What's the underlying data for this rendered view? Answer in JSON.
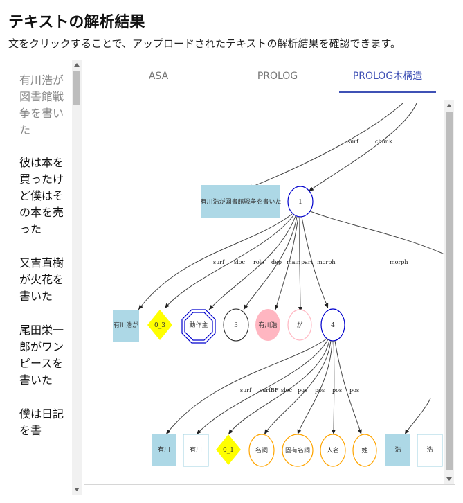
{
  "header": {
    "title": "テキストの解析結果",
    "subtitle": "文をクリックすることで、アップロードされたテキストの解析結果を確認できます。"
  },
  "sentences": [
    "有川浩が図書館戦争を書いた",
    "彼は本を買ったけど僕はその本を売った",
    "又吉直樹が火花を書いた",
    "尾田栄一郎がワンピースを書いた",
    "僕は日記を書"
  ],
  "tabs": [
    {
      "label": "ASA"
    },
    {
      "label": "PROLOG"
    },
    {
      "label": "PROLOG木構造"
    }
  ],
  "active_tab": "PROLOG木構造",
  "colors": {
    "accent": "#3f51b5",
    "surf_node": "#ADD8E6",
    "sloc_node": "#FFFF00",
    "role_node": "#0000CD",
    "main_node": "#FFB6C1",
    "pos_node": "#FFA500"
  },
  "graph": {
    "top_edge_labels": {
      "surf": "surf",
      "chunk": "chunk"
    },
    "chunk_surf": "有川浩が図書館戦争を書いた",
    "chunk_id": "1",
    "chunk_edge_labels": [
      "surf",
      "sloc",
      "role",
      "dep",
      "main",
      "part",
      "morph",
      "morph"
    ],
    "chunk_children": {
      "surf": "有川浩が",
      "sloc": "0_3",
      "role": "動作主",
      "dep": "3",
      "main": "有川浩",
      "part": "が",
      "morph": "4"
    },
    "morph_edge_labels": [
      "surf",
      "surfBF",
      "sloc",
      "pos",
      "pos",
      "pos",
      "pos"
    ],
    "morph_children": {
      "surf": "有川",
      "surfBF": "有川",
      "sloc": "0_1",
      "pos": [
        "名詞",
        "固有名詞",
        "人名",
        "姓"
      ]
    },
    "next_morph": {
      "surf": "浩",
      "surfBF": "浩"
    }
  }
}
